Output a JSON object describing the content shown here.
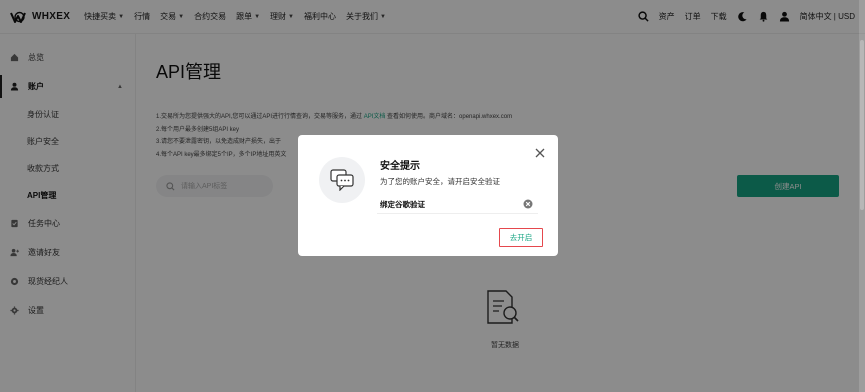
{
  "brand": {
    "name": "WHXEX",
    "accent": "#17a583"
  },
  "nav": {
    "items": [
      {
        "label": "快捷买卖",
        "dropdown": true
      },
      {
        "label": "行情",
        "dropdown": false
      },
      {
        "label": "交易",
        "dropdown": true
      },
      {
        "label": "合约交易",
        "dropdown": false
      },
      {
        "label": "跟单",
        "dropdown": true
      },
      {
        "label": "理财",
        "dropdown": true
      },
      {
        "label": "福利中心",
        "dropdown": false
      },
      {
        "label": "关于我们",
        "dropdown": true
      }
    ],
    "right": {
      "assets": "资产",
      "orders": "订单",
      "download": "下载",
      "language": "简体中文 | USD"
    }
  },
  "sidebar": {
    "items": [
      {
        "label": "总览",
        "icon": "home-icon"
      },
      {
        "label": "账户",
        "icon": "user-icon"
      },
      {
        "label": "任务中心",
        "icon": "task-icon"
      },
      {
        "label": "邀请好友",
        "icon": "invite-icon"
      },
      {
        "label": "现货经纪人",
        "icon": "broker-icon"
      },
      {
        "label": "设置",
        "icon": "gear-icon"
      }
    ],
    "account_sub": [
      "身份认证",
      "账户安全",
      "收款方式",
      "API管理"
    ]
  },
  "main": {
    "title": "API管理",
    "notes": {
      "line1_pre": "1.交易所为您提供强大的API,您可以通过API进行行情查询，交易等服务，通过",
      "line1_link": "API文档",
      "line1_post": "查看如何使用。商户域名：openapi.whxex.com",
      "line2": "2.每个用户最多创建5组API key",
      "line3": "3.请您不要泄露密钥，以免造成财产损失，出于",
      "line4": "4.每个API key最多绑定5个IP，多个IP地址用英文"
    },
    "search_placeholder": "请输入API标签",
    "create_button": "创建API",
    "empty_text": "暂无数据"
  },
  "modal": {
    "title": "安全提示",
    "description": "为了您的账户安全，请开启安全验证",
    "row_label": "绑定谷歌验证",
    "action": "去开启"
  }
}
